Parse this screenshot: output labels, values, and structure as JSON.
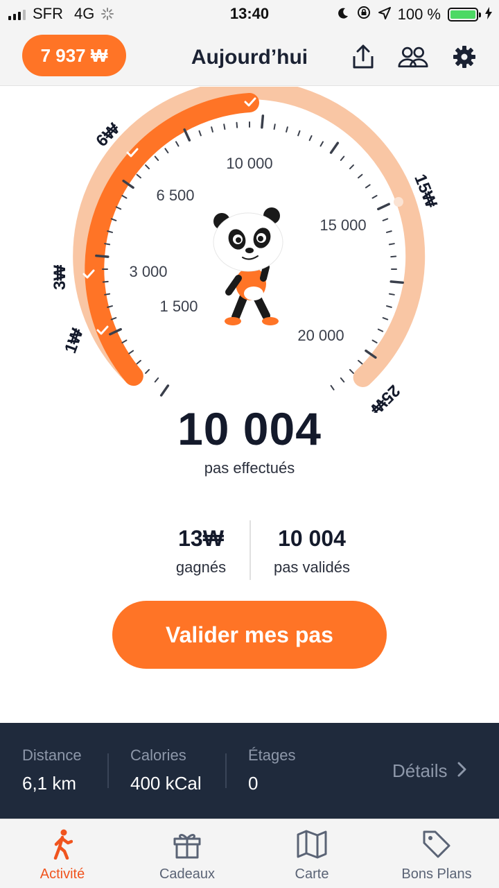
{
  "status_bar": {
    "carrier": "SFR",
    "network": "4G",
    "time": "13:40",
    "battery": "100 %",
    "battery_level": 1.0
  },
  "header": {
    "points": "7 937 ₩",
    "title": "Aujourd’hui",
    "icons": [
      "share-icon",
      "friends-icon",
      "gear-icon"
    ]
  },
  "gauge": {
    "progress_steps": 10004,
    "max_steps": 25000,
    "tick_labels": [
      "1 500",
      "3 000",
      "6 500",
      "10 000",
      "15 000",
      "20 000"
    ],
    "reward_labels": [
      "1₩",
      "3₩",
      "6₩",
      "15₩",
      "25₩"
    ],
    "colors": {
      "filled": "#ff7426",
      "remaining": "#f9c6a4"
    }
  },
  "steps": {
    "count": "10 004",
    "caption": "pas effectués"
  },
  "summary": {
    "earned_value": "13₩",
    "earned_label": "gagnés",
    "validated_value": "10 004",
    "validated_label": "pas validés"
  },
  "validate_button": "Valider mes pas",
  "info_bar": {
    "distance_label": "Distance",
    "distance_value": "6,1 km",
    "calories_label": "Calories",
    "calories_value": "400 kCal",
    "floors_label": "Étages",
    "floors_value": "0",
    "details_label": "Détails"
  },
  "tabs": [
    {
      "label": "Activité",
      "icon": "walking-icon",
      "active": true
    },
    {
      "label": "Cadeaux",
      "icon": "gift-icon",
      "active": false
    },
    {
      "label": "Carte",
      "icon": "map-icon",
      "active": false
    },
    {
      "label": "Bons Plans",
      "icon": "tag-icon",
      "active": false
    }
  ],
  "colors": {
    "accent": "#ff7426",
    "dark": "#1f2a3c",
    "active_tab": "#f0541e"
  }
}
